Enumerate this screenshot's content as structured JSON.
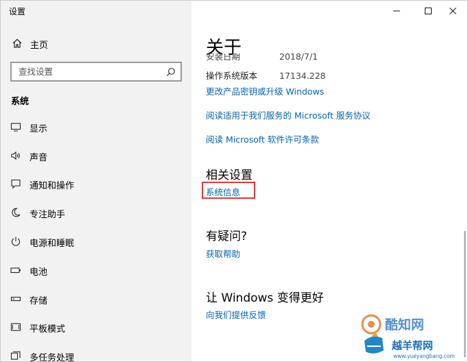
{
  "window": {
    "title": "设置"
  },
  "sidebar": {
    "home_label": "主页",
    "search_placeholder": "查找设置",
    "section_title": "系统",
    "items": [
      {
        "label": "显示",
        "icon": "monitor-icon"
      },
      {
        "label": "声音",
        "icon": "speaker-icon"
      },
      {
        "label": "通知和操作",
        "icon": "notification-icon"
      },
      {
        "label": "专注助手",
        "icon": "moon-icon"
      },
      {
        "label": "电源和睡眠",
        "icon": "power-icon"
      },
      {
        "label": "电池",
        "icon": "battery-icon"
      },
      {
        "label": "存储",
        "icon": "storage-icon"
      },
      {
        "label": "平板模式",
        "icon": "tablet-icon"
      },
      {
        "label": "多任务处理",
        "icon": "multitask-icon"
      }
    ]
  },
  "content": {
    "title": "关于",
    "install_date_label": "安装日期",
    "install_date_value": "2018/7/1",
    "os_version_label": "操作系统版本",
    "os_version_value": "17134.228",
    "links": {
      "change_key": "更改产品密钥或升级 Windows",
      "service_agreement": "阅读适用于我们服务的 Microsoft 服务协议",
      "license_terms": "阅读 Microsoft 软件许可条款"
    },
    "related_settings": {
      "heading": "相关设置",
      "system_info": "系统信息"
    },
    "questions": {
      "heading": "有疑问?",
      "get_help": "获取帮助"
    },
    "improve": {
      "heading": "让 Windows 变得更好",
      "feedback": "向我们提供反馈"
    }
  },
  "watermark": {
    "text_top": "酷知网",
    "text_main": "越羊帮网",
    "text_url": "www.yueyangbang.com"
  },
  "colors": {
    "link": "#0063b1",
    "sidebar_bg": "#f2f2f2",
    "highlight": "#d93a3a"
  }
}
